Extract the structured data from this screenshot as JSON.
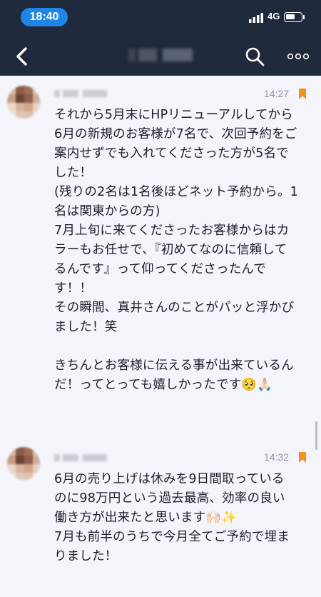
{
  "status_bar": {
    "time": "18:40",
    "network": "4G"
  },
  "header": {
    "back_icon": "chevron-left-icon",
    "search_icon": "search-icon",
    "more_icon": "more-icon"
  },
  "messages": [
    {
      "time": "14:27",
      "lines": [
        "それから5月末にHPリニューアルしてから",
        "6月の新規のお客様が7名で、次回予約をご",
        "案内せずでも入れてくださった方が5名で",
        "した！",
        "(残りの2名は1名後ほどネット予約から。1",
        "名は関東からの方)",
        "7月上旬に来てくださったお客様からはカ",
        "ラーもお任せで、『初めてなのに信頼して",
        "るんです』って仰ってくださったんで",
        "す！！",
        "その瞬間、真井さんのことがパッと浮かび",
        "ました！笑",
        "",
        "きちんとお客様に伝える事が出来ているん",
        "だ！ってとっても嬉しかったです🥺🙏🏻"
      ]
    },
    {
      "time": "14:32",
      "lines": [
        "6月の売り上げは休みを9日間取っている",
        "のに98万円という過去最高、効率の良い",
        "働き方が出来たと思います🙌🏻✨",
        "7月も前半のうちで今月全てご予約で埋ま",
        "りました！"
      ]
    }
  ],
  "colors": {
    "header_bg": "#1f2a3c",
    "time_pill": "#1f86e8",
    "bookmark": "#f0921c",
    "page_bg": "#f4f5fb"
  }
}
